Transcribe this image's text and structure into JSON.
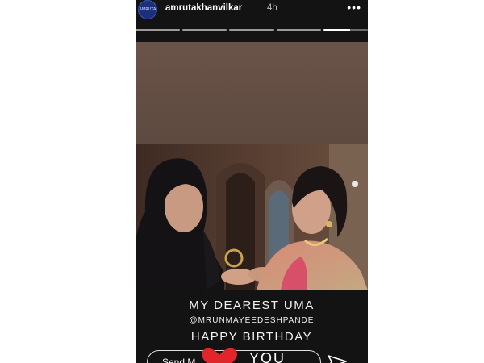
{
  "header": {
    "avatar_text": "AMRUTA",
    "username": "amrutakhanvilkar",
    "time": "4h",
    "more_icon": "more-dots-icon",
    "progress_segments": 5,
    "active_segment_progress": 0.6
  },
  "story": {
    "caption_line1": "MY DEAREST UMA",
    "caption_line2": "@MRUNMAYEEDESHPANDE",
    "caption_line3": "HAPPY BIRTHDAY",
    "sticker_text": "YOU",
    "sticker_icon": "heart-icon"
  },
  "footer": {
    "reply_placeholder": "Send M",
    "send_icon": "send-icon"
  },
  "colors": {
    "story_bg": "#131313",
    "brown_block": "#6a5349",
    "heart": "#e0262b",
    "avatar_bg": "#1c2f7a"
  }
}
